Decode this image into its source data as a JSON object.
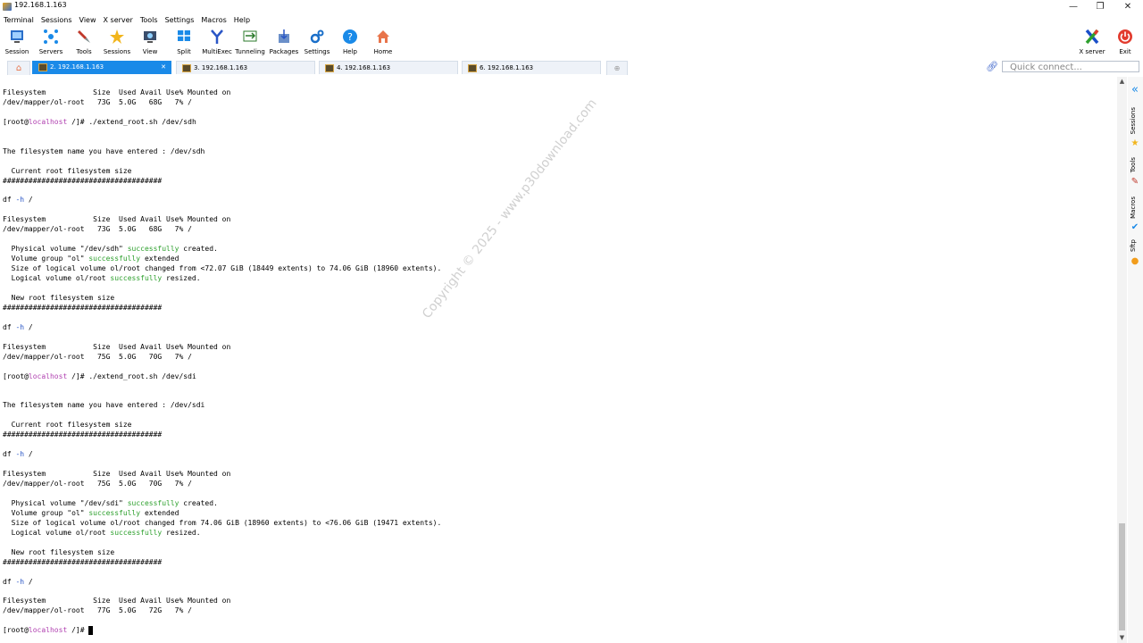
{
  "window": {
    "title": "192.168.1.163",
    "controls": {
      "minimize": "—",
      "restore": "❐",
      "close": "✕"
    }
  },
  "menu": [
    "Terminal",
    "Sessions",
    "View",
    "X server",
    "Tools",
    "Settings",
    "Macros",
    "Help"
  ],
  "toolbar": {
    "buttons": [
      {
        "label": "Session",
        "icon": "session-icon"
      },
      {
        "label": "Servers",
        "icon": "servers-icon"
      },
      {
        "label": "Tools",
        "icon": "tools-icon"
      },
      {
        "label": "Sessions",
        "icon": "star-icon"
      },
      {
        "label": "View",
        "icon": "view-icon"
      },
      {
        "label": "Split",
        "icon": "split-icon"
      },
      {
        "label": "MultiExec",
        "icon": "multiexec-icon"
      },
      {
        "label": "Tunneling",
        "icon": "tunneling-icon"
      },
      {
        "label": "Packages",
        "icon": "packages-icon"
      },
      {
        "label": "Settings",
        "icon": "settings-icon"
      },
      {
        "label": "Help",
        "icon": "help-icon"
      },
      {
        "label": "Home",
        "icon": "home-icon"
      }
    ],
    "xserver_label": "X server",
    "exit_label": "Exit"
  },
  "tabs": [
    {
      "label": "2. 192.168.1.163",
      "active": true
    },
    {
      "label": "3. 192.168.1.163",
      "active": false
    },
    {
      "label": "4. 192.168.1.163",
      "active": false
    },
    {
      "label": "6. 192.168.1.163",
      "active": false
    }
  ],
  "quick_connect": {
    "placeholder": "Quick connect..."
  },
  "watermark": "Copyright © 2025 - www.p30download.com",
  "sidebar_right": [
    "Sessions",
    "Tools",
    "Macros",
    "Sftp"
  ],
  "terminal": {
    "prompt_host": "localhost",
    "lines": [
      "Filesystem           Size  Used Avail Use% Mounted on",
      "/dev/mapper/ol-root   73G  5.0G   68G   7% /",
      "",
      "[root@localhost /]# ./extend_root.sh /dev/sdh",
      "",
      "",
      "The filesystem name you have entered : /dev/sdh",
      "",
      "  Current root filesystem size",
      "#####################################",
      "",
      "df -h /",
      "",
      "Filesystem           Size  Used Avail Use% Mounted on",
      "/dev/mapper/ol-root   73G  5.0G   68G   7% /",
      "",
      "  Physical volume \"/dev/sdh\" successfully created.",
      "  Volume group \"ol\" successfully extended",
      "  Size of logical volume ol/root changed from <72.07 GiB (18449 extents) to 74.06 GiB (18960 extents).",
      "  Logical volume ol/root successfully resized.",
      "",
      "  New root filesystem size",
      "#####################################",
      "",
      "df -h /",
      "",
      "Filesystem           Size  Used Avail Use% Mounted on",
      "/dev/mapper/ol-root   75G  5.0G   70G   7% /",
      "",
      "[root@localhost /]# ./extend_root.sh /dev/sdi",
      "",
      "",
      "The filesystem name you have entered : /dev/sdi",
      "",
      "  Current root filesystem size",
      "#####################################",
      "",
      "df -h /",
      "",
      "Filesystem           Size  Used Avail Use% Mounted on",
      "/dev/mapper/ol-root   75G  5.0G   70G   7% /",
      "",
      "  Physical volume \"/dev/sdi\" successfully created.",
      "  Volume group \"ol\" successfully extended",
      "  Size of logical volume ol/root changed from 74.06 GiB (18960 extents) to <76.06 GiB (19471 extents).",
      "  Logical volume ol/root successfully resized.",
      "",
      "  New root filesystem size",
      "#####################################",
      "",
      "df -h /",
      "",
      "Filesystem           Size  Used Avail Use% Mounted on",
      "/dev/mapper/ol-root   77G  5.0G   72G   7% /",
      "",
      "[root@localhost /]# "
    ]
  },
  "colors": {
    "accent": "#1a8ae8",
    "success": "#2ea02e",
    "host": "#b040b0",
    "option": "#2a56c6"
  }
}
